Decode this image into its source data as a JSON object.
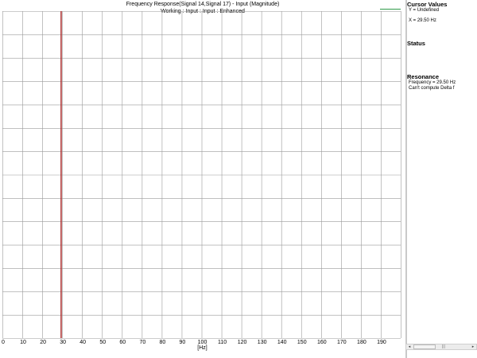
{
  "chart_data": {
    "type": "line",
    "title": "Frequency Response(Signal 14,Signal 17) - Input (Magnitude)",
    "subtitle": "Working : Input : Input : Enhanced",
    "xlabel": "[Hz]",
    "xlim": [
      0,
      200
    ],
    "x_ticks": [
      "0",
      "10",
      "20",
      "30",
      "40",
      "50",
      "60",
      "70",
      "80",
      "90",
      "100",
      "110",
      "120",
      "130",
      "140",
      "150",
      "160",
      "170",
      "180",
      "190"
    ],
    "x_tick_values": [
      0,
      10,
      20,
      30,
      40,
      50,
      60,
      70,
      80,
      90,
      100,
      110,
      120,
      130,
      140,
      150,
      160,
      170,
      180,
      190
    ],
    "grid": true,
    "horizontal_gridlines": 14,
    "series": [],
    "series_color": "#2f9a4a",
    "cursor": {
      "x": 29.5,
      "color": "#b23a3a"
    }
  },
  "side_panel": {
    "cursor_values": {
      "heading": "Cursor Values",
      "y_line": "Y = Undefined",
      "x_line": "X = 29.50 Hz"
    },
    "status": {
      "heading": "Status"
    },
    "resonance": {
      "heading": "Resonance",
      "frequency_line": "Frequency = 29.50 Hz",
      "delta_line": "Can't compute Delta f"
    }
  },
  "scrollbar": {
    "left_arrow": "◂",
    "grip": "|||",
    "right_arrow": "▸"
  }
}
